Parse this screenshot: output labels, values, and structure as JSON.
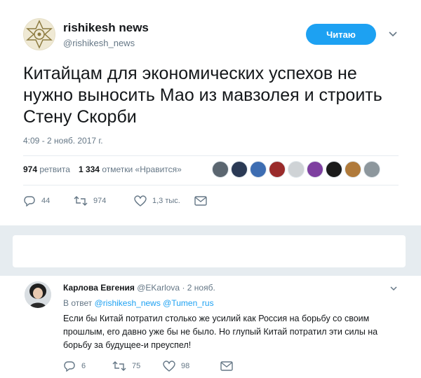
{
  "tweet": {
    "author": {
      "name": "rishikesh news",
      "handle": "@rishikesh_news"
    },
    "follow_label": "Читаю",
    "text": "Китайцам для экономических успехов не нужно выносить Мао из мавзолея и строить Стену Скорби",
    "timestamp": "4:09 - 2 нояб. 2017 г.",
    "stats": {
      "retweets_count": "974",
      "retweets_label": "ретвита",
      "likes_count": "1 334",
      "likes_label": "отметки «Нравится»"
    },
    "likers_icons": [
      "avatar-1",
      "avatar-2",
      "avatar-3",
      "avatar-4",
      "avatar-5",
      "avatar-6",
      "avatar-7",
      "avatar-8",
      "avatar-9"
    ],
    "actions": {
      "replies": "44",
      "retweets": "974",
      "likes": "1,3 тыс."
    }
  },
  "reply": {
    "name": "Карлова Евгения",
    "handle": "@EKarlova",
    "time": "· 2 нояб.",
    "in_reply_prefix": "В ответ",
    "mention1": "@rishikesh_news",
    "mention2": "@Tumen_rus",
    "text": "Если бы Китай потратил столько же усилий как Россия на борьбу со своим прошлым, его давно уже бы не было. Но глупый Китай потратил эти силы на борьбу за будущее-и преуспел!",
    "actions": {
      "replies": "6",
      "retweets": "75",
      "likes": "98"
    }
  },
  "colors": {
    "accent": "#1da1f2",
    "muted": "#657786",
    "band": "#e6ecf0"
  }
}
